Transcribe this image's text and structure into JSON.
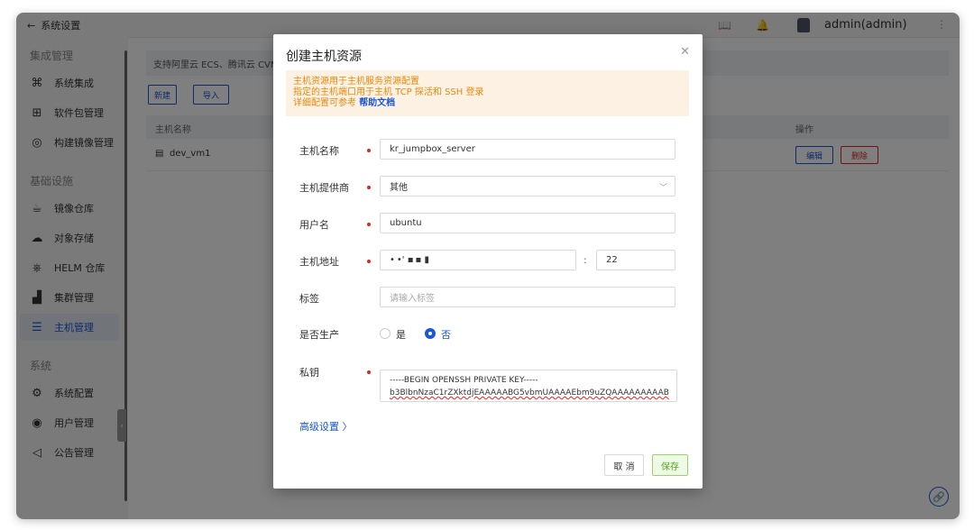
{
  "sidebar": {
    "back_label": "系统设置",
    "sections": [
      {
        "title": "集成管理",
        "items": [
          {
            "label": "系统集成",
            "icon": "integration-icon"
          },
          {
            "label": "软件包管理",
            "icon": "package-icon"
          },
          {
            "label": "构建镜像管理",
            "icon": "build-image-icon"
          }
        ]
      },
      {
        "title": "基础设施",
        "items": [
          {
            "label": "镜像仓库",
            "icon": "registry-icon"
          },
          {
            "label": "对象存储",
            "icon": "cloud-storage-icon"
          },
          {
            "label": "HELM 仓库",
            "icon": "helm-icon"
          },
          {
            "label": "集群管理",
            "icon": "cluster-icon"
          },
          {
            "label": "主机管理",
            "icon": "host-icon",
            "active": true
          }
        ]
      },
      {
        "title": "系统",
        "items": [
          {
            "label": "系统配置",
            "icon": "settings-icon"
          },
          {
            "label": "用户管理",
            "icon": "user-icon"
          },
          {
            "label": "公告管理",
            "icon": "announcement-icon"
          }
        ]
      }
    ]
  },
  "topbar": {
    "user": "admin(admin)"
  },
  "main": {
    "notice": "支持阿里云 ECS、腾讯云 CVM",
    "new_label": "新建",
    "import_label": "导入",
    "table": {
      "col_name": "主机名称",
      "col_ops": "操作",
      "rows": [
        {
          "name": "dev_vm1",
          "edit": "编辑",
          "delete": "删除"
        }
      ]
    }
  },
  "modal": {
    "title": "创建主机资源",
    "tip": {
      "line1": "主机资源用于主机服务资源配置",
      "line2": "指定的主机端口用于主机 TCP 探活和 SSH 登录",
      "line3_prefix": "详细配置可参考",
      "line3_link": "帮助文档"
    },
    "fields": {
      "name_label": "主机名称",
      "name_value": "kr_jumpbox_server",
      "provider_label": "主机提供商",
      "provider_value": "其他",
      "user_label": "用户名",
      "user_value": "ubuntu",
      "addr_label": "主机地址",
      "addr_value": "• •' ▪ ▪ ▮",
      "port_sep": ":",
      "port_value": "22",
      "tag_label": "标签",
      "tag_placeholder": "请输入标签",
      "prod_label": "是否生产",
      "prod_yes": "是",
      "prod_no": "否",
      "prod_selected": "否",
      "key_label": "私钥",
      "key_line1": "-----BEGIN OPENSSH PRIVATE KEY-----",
      "key_line2": "b3BlbnNzaC1rZXktdjEAAAAABG5vbmUAAAAEbm9uZQAAAAAAAAAB"
    },
    "advanced_label": "高级设置 〉",
    "cancel_label": "取 消",
    "save_label": "保存"
  },
  "colors": {
    "accent": "#1a56db",
    "required": "#e02424",
    "tip_bg": "#fdf1e3",
    "tip_text": "#e8890c",
    "save_green": "#52a81c"
  }
}
